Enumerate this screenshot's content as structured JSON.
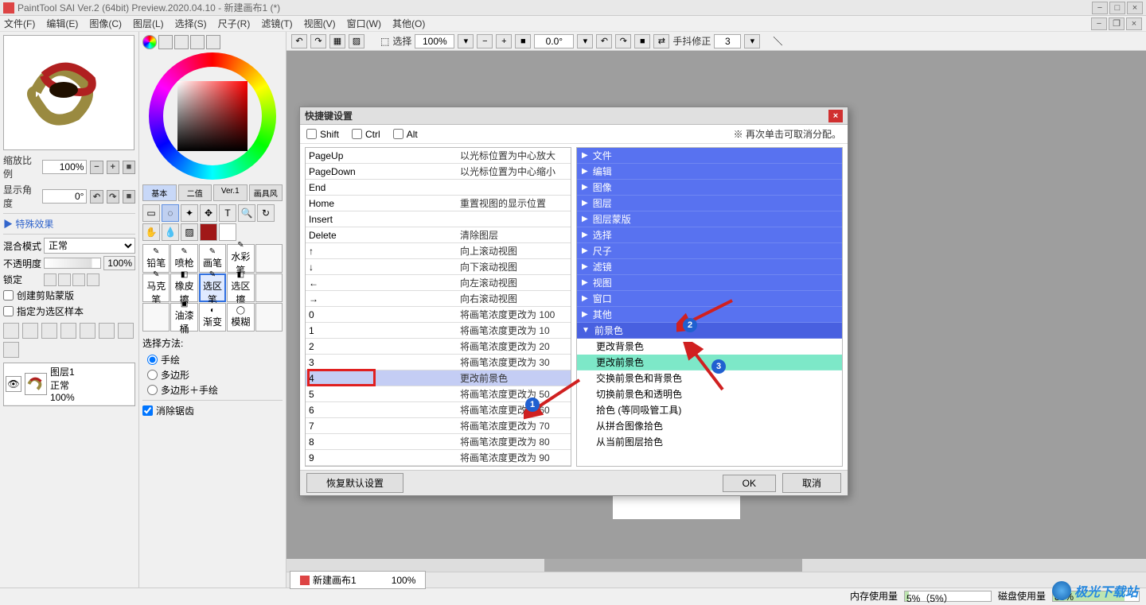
{
  "app": {
    "title": "PaintTool SAI Ver.2 (64bit) Preview.2020.04.10 - 新建画布1 (*)"
  },
  "menu": [
    "文件(F)",
    "编辑(E)",
    "图像(C)",
    "图层(L)",
    "选择(S)",
    "尺子(R)",
    "滤镜(T)",
    "视图(V)",
    "窗口(W)",
    "其他(O)"
  ],
  "left": {
    "scale_label": "缩放比例",
    "scale_value": "100%",
    "angle_label": "显示角度",
    "angle_value": "0°",
    "fx": "▶ 特殊效果",
    "blend_label": "混合模式",
    "blend_value": "正常",
    "opacity_label": "不透明度",
    "opacity_value": "100%",
    "lock_label": "锁定",
    "clip_label": "创建剪贴蒙版",
    "sample_label": "指定为选区样本",
    "layer": {
      "name": "图层1",
      "mode": "正常",
      "opacity": "100%"
    }
  },
  "tools": {
    "tabs": [
      "基本",
      "二值",
      "Ver.1",
      "画具风"
    ],
    "brushes": [
      "铅笔",
      "喷枪",
      "画笔",
      "水彩笔",
      "马克笔",
      "橡皮擦",
      "选区笔",
      "选区擦",
      "",
      "油漆桶",
      "渐变",
      "模糊"
    ],
    "sel_label": "选择方法:",
    "sel_opts": [
      "手绘",
      "多边形",
      "多边形＋手绘"
    ],
    "antialias": "消除锯齿"
  },
  "canvas_toolbar": {
    "select_label": "选择",
    "zoom": "100%",
    "angle": "0.0°",
    "stabilizer_label": "手抖修正",
    "stabilizer_value": "3"
  },
  "doc_tab": {
    "name": "新建画布1",
    "zoom": "100%"
  },
  "status": {
    "mem_label": "内存使用量",
    "mem_value": "5%（5%）",
    "disk_label": "磁盘使用量",
    "disk_value": "83%"
  },
  "dialog": {
    "title": "快捷键设置",
    "mod_shift": "Shift",
    "mod_ctrl": "Ctrl",
    "mod_alt": "Alt",
    "hint": "※ 再次单击可取消分配。",
    "shortcuts": [
      {
        "key": "PageUp",
        "action": "以光标位置为中心放大"
      },
      {
        "key": "PageDown",
        "action": "以光标位置为中心缩小"
      },
      {
        "key": "End",
        "action": ""
      },
      {
        "key": "Home",
        "action": "重置视图的显示位置"
      },
      {
        "key": "Insert",
        "action": ""
      },
      {
        "key": "Delete",
        "action": "清除图层"
      },
      {
        "key": "↑",
        "action": "向上滚动视图"
      },
      {
        "key": "↓",
        "action": "向下滚动视图"
      },
      {
        "key": "←",
        "action": "向左滚动视图"
      },
      {
        "key": "→",
        "action": "向右滚动视图"
      },
      {
        "key": "0",
        "action": "将画笔浓度更改为 100"
      },
      {
        "key": "1",
        "action": "将画笔浓度更改为 10"
      },
      {
        "key": "2",
        "action": "将画笔浓度更改为 20"
      },
      {
        "key": "3",
        "action": "将画笔浓度更改为 30"
      },
      {
        "key": "4",
        "action": "更改前景色"
      },
      {
        "key": "5",
        "action": "将画笔浓度更改为 50"
      },
      {
        "key": "6",
        "action": "将画笔浓度更改为 60"
      },
      {
        "key": "7",
        "action": "将画笔浓度更改为 70"
      },
      {
        "key": "8",
        "action": "将画笔浓度更改为 80"
      },
      {
        "key": "9",
        "action": "将画笔浓度更改为 90"
      }
    ],
    "categories": [
      {
        "type": "group",
        "label": "文件"
      },
      {
        "type": "group",
        "label": "编辑"
      },
      {
        "type": "group",
        "label": "图像"
      },
      {
        "type": "group",
        "label": "图层"
      },
      {
        "type": "group",
        "label": "图层蒙版"
      },
      {
        "type": "group",
        "label": "选择"
      },
      {
        "type": "group",
        "label": "尺子"
      },
      {
        "type": "group",
        "label": "滤镜"
      },
      {
        "type": "group",
        "label": "视图"
      },
      {
        "type": "group",
        "label": "窗口"
      },
      {
        "type": "group",
        "label": "其他"
      },
      {
        "type": "group-open",
        "label": "前景色"
      },
      {
        "type": "leaf",
        "label": "更改背景色"
      },
      {
        "type": "leaf-hl",
        "label": "更改前景色"
      },
      {
        "type": "leaf",
        "label": "交换前景色和背景色"
      },
      {
        "type": "leaf",
        "label": "切换前景色和透明色"
      },
      {
        "type": "leaf",
        "label": "拾色 (等同吸管工具)"
      },
      {
        "type": "leaf",
        "label": "从拼合图像拾色"
      },
      {
        "type": "leaf",
        "label": "从当前图层拾色"
      }
    ],
    "reset": "恢复默认设置",
    "ok": "OK",
    "cancel": "取消"
  },
  "watermark": "极光下载站",
  "badges": {
    "b1": "1",
    "b2": "2",
    "b3": "3"
  }
}
